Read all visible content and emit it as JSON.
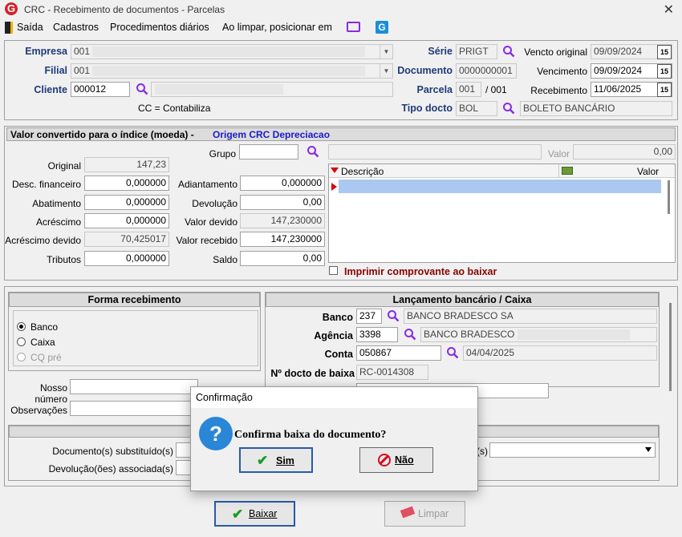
{
  "window": {
    "title": "CRC - Recebimento de documentos - Parcelas",
    "close": "✕"
  },
  "menu": {
    "exit": "Saída",
    "cadastros": "Cadastros",
    "procedimentos": "Procedimentos diários",
    "ao_limpar": "Ao limpar, posicionar em"
  },
  "header": {
    "empresa_label": "Empresa",
    "empresa_code": "001",
    "filial_label": "Filial",
    "filial_code": "001",
    "cliente_label": "Cliente",
    "cliente_code": "000012",
    "cc_note": "CC = Contabiliza",
    "serie_label": "Série",
    "serie_value": "PRIGT",
    "documento_label": "Documento",
    "documento_value": "0000000001",
    "parcela_label": "Parcela",
    "parcela_value": "001",
    "parcela_total": "/ 001",
    "tipo_label": "Tipo docto",
    "tipo_value": "BOL",
    "tipo_desc": "BOLETO BANCÁRIO",
    "vencto_original_label": "Vencto original",
    "vencto_original_value": "09/09/2024",
    "vencimento_label": "Vencimento",
    "vencimento_value": "09/09/2024",
    "recebimento_label": "Recebimento",
    "recebimento_value": "11/06/2025",
    "cal_icon_text": "15"
  },
  "valores": {
    "section_title": "Valor convertido para o índice (moeda) -",
    "section_overlap": "Origem CRC Depreciacao",
    "original_label": "Original",
    "original_value": "147,23",
    "desc_fin_label": "Desc. financeiro",
    "desc_fin_value": "0,000000",
    "abatimento_label": "Abatimento",
    "abatimento_value": "0,000000",
    "acrescimo_label": "Acréscimo",
    "acrescimo_value": "0,000000",
    "acrescimo_devido_label": "Acréscimo devido",
    "acrescimo_devido_value": "70,425017",
    "tributos_label": "Tributos",
    "tributos_value": "0,000000",
    "grupo_label": "Grupo",
    "adiantamento_label": "Adiantamento",
    "adiantamento_value": "0,000000",
    "devolucao_label": "Devolução",
    "devolucao_value": "0,00",
    "valor_devido_label": "Valor devido",
    "valor_devido_value": "147,230000",
    "valor_recebido_label": "Valor recebido",
    "valor_recebido_value": "147,230000",
    "saldo_label": "Saldo",
    "saldo_value": "0,00",
    "valor_label": "Valor",
    "valor_value": "0,00",
    "grid_col_descricao": "Descrição",
    "grid_col_valor": "Valor",
    "imprimir_label": "Imprimir comprovante ao baixar"
  },
  "forma": {
    "title": "Forma recebimento",
    "banco": "Banco",
    "caixa": "Caixa",
    "cq_pre": "CQ pré",
    "nosso_numero_label": "Nosso número",
    "observacoes_label": "Observações",
    "doc_substituidos_label": "Documento(s) substituído(s)",
    "devolucoes_label": "Devolução(ões) associada(s)"
  },
  "lancamento": {
    "title": "Lançamento bancário / Caixa",
    "banco_label": "Banco",
    "banco_code": "237",
    "banco_name": "BANCO BRADESCO SA",
    "agencia_label": "Agência",
    "agencia_code": "3398",
    "agencia_name": "BANCO BRADESCO -",
    "conta_label": "Conta",
    "conta_code": "050867",
    "conta_date": "04/04/2025",
    "docto_baixa_label": "Nº docto de baixa",
    "docto_baixa_value": "RC-0014308",
    "partial_label": "(s)"
  },
  "dialog": {
    "title": "Confirmação",
    "message": "Confirma baixa  do documento?",
    "sim": "Sim",
    "nao": "Não",
    "question_mark": "?"
  },
  "footer": {
    "baixar": "Baixar",
    "limpar": "Limpar"
  }
}
